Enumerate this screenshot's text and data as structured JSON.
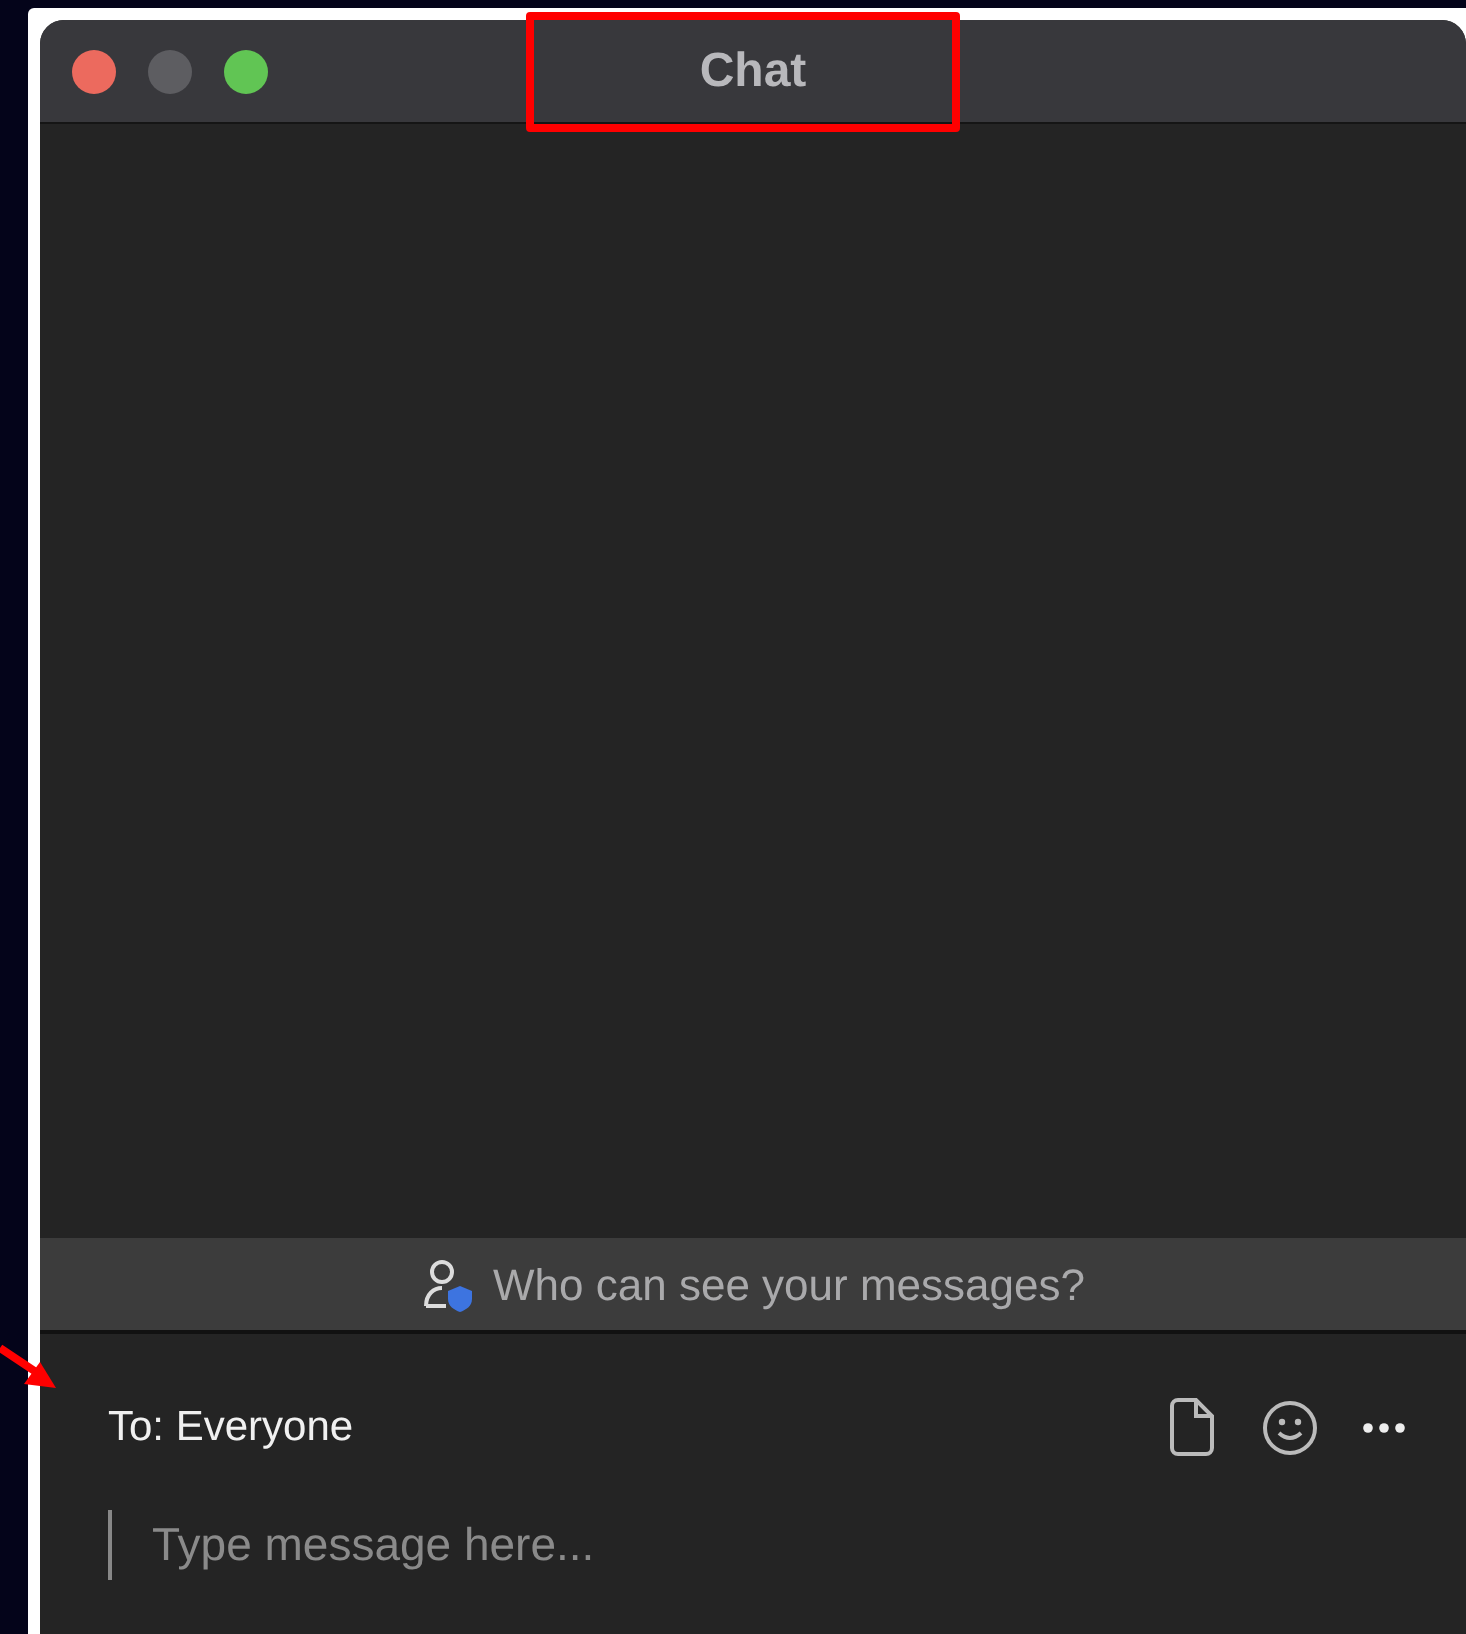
{
  "window": {
    "title": "Chat"
  },
  "privacy_banner": {
    "text": "Who can see your messages?"
  },
  "compose": {
    "recipient": "To: Everyone",
    "placeholder": "Type message here..."
  }
}
